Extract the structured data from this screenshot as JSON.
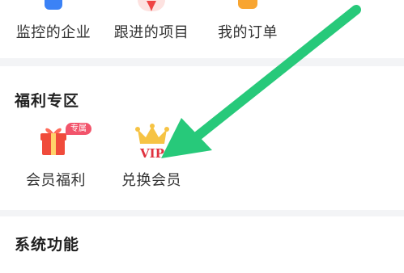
{
  "top_row": {
    "items": [
      {
        "label": "监控的企业",
        "icon": "building-icon"
      },
      {
        "label": "跟进的项目",
        "icon": "star-icon"
      },
      {
        "label": "我的订单",
        "icon": "order-icon"
      }
    ]
  },
  "welfare": {
    "title": "福利专区",
    "items": [
      {
        "label": "会员福利",
        "icon": "gift-icon",
        "badge": "专属"
      },
      {
        "label": "兑换会员",
        "icon": "vip-crown-icon",
        "icon_text": "VIP"
      }
    ]
  },
  "system": {
    "title": "系统功能"
  },
  "colors": {
    "annotation_arrow": "#27c97a",
    "gift_red": "#f04b3b",
    "badge": "#f2546b",
    "vip_gold": "#f6c344",
    "vip_red": "#e0323f"
  }
}
